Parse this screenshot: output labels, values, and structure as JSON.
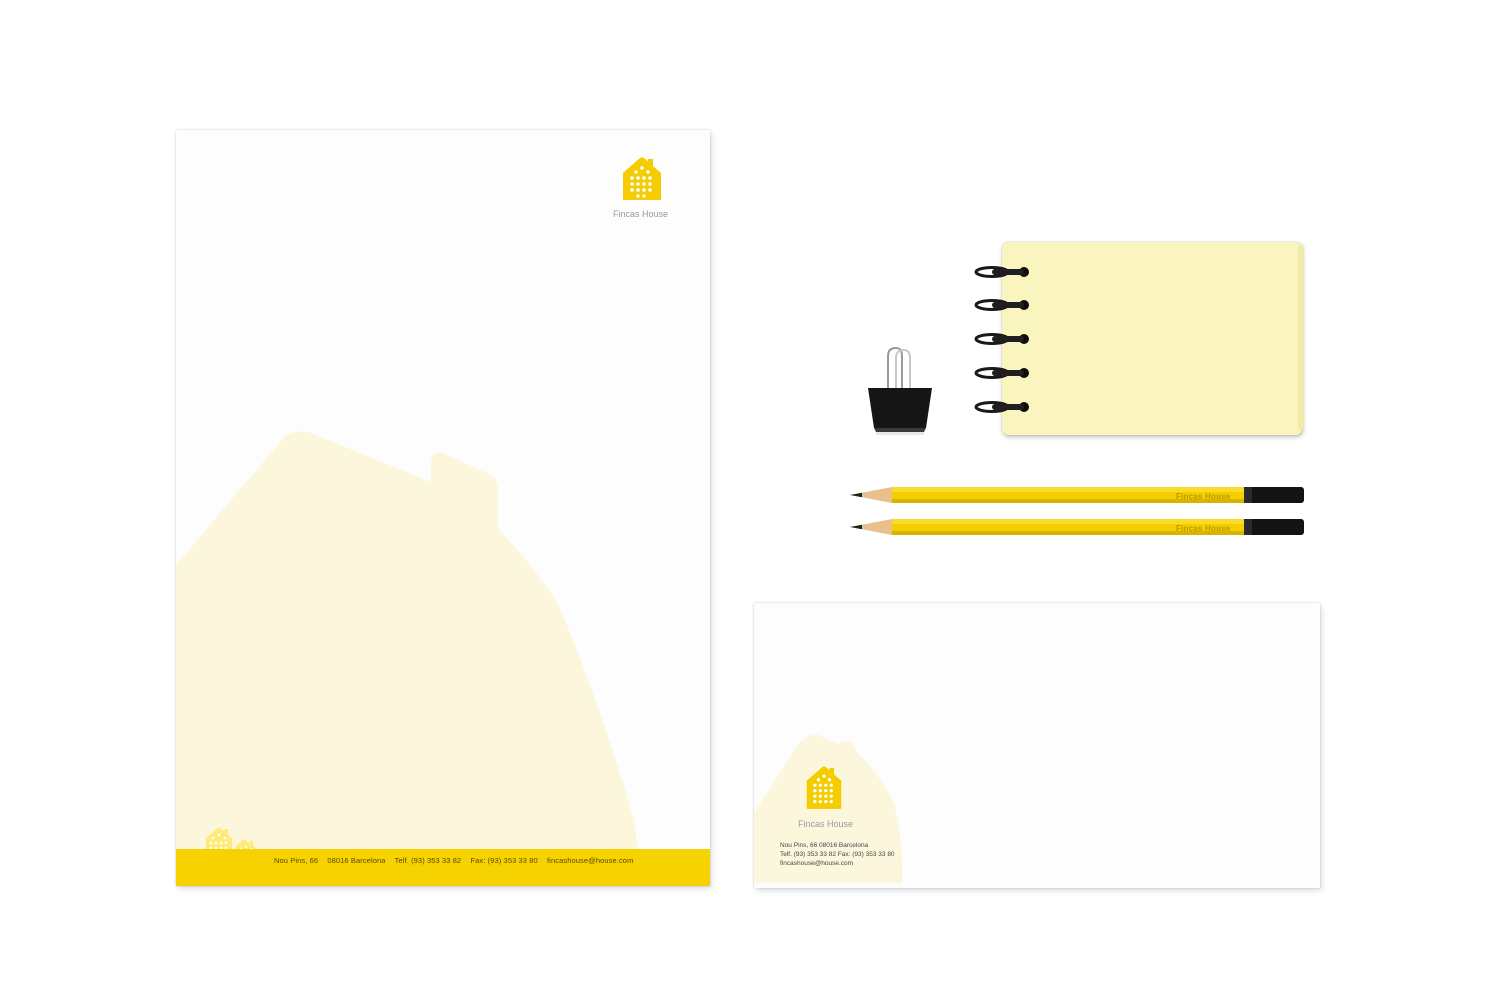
{
  "brand": {
    "name": "Fincas House",
    "accent_color": "#f6d200",
    "watermark_color": "#fcf7dc"
  },
  "letterhead": {
    "logo_caption": "Fincas House",
    "footer": {
      "address": "Nou Pins, 66",
      "city": "08016 Barcelona",
      "phone": "Telf. (93) 353 33 82",
      "fax": "Fax: (93) 353 33 80",
      "email": "fincashouse@house.com"
    }
  },
  "envelope": {
    "logo_caption": "Fincas House",
    "lines": [
      "Nou Pins, 66   08016 Barcelona",
      "Telf. (93) 353 33 82   Fax: (93) 353 33 80",
      "fincashouse@house.com"
    ]
  },
  "pencils": [
    {
      "label": "Fincas House"
    },
    {
      "label": "Fincas House"
    }
  ],
  "icons": {
    "logo": "house-logo-icon",
    "binder_clip": "binder-clip-icon"
  }
}
